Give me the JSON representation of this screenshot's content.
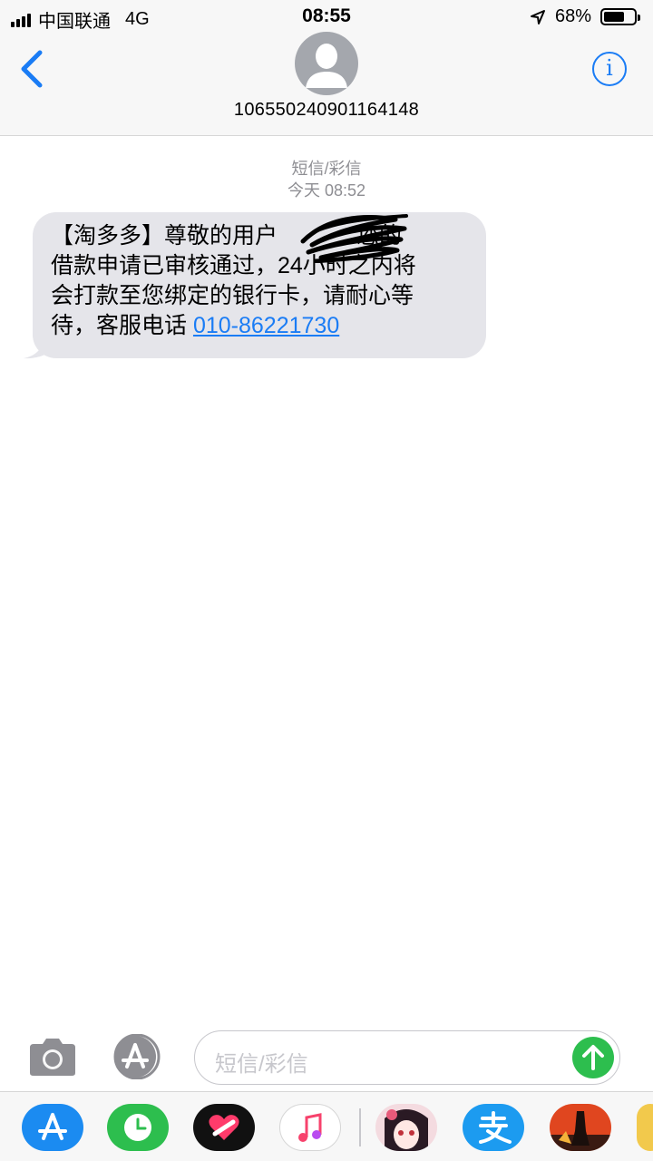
{
  "status_bar": {
    "carrier": "中国联通",
    "network": "4G",
    "time": "08:55",
    "battery_percent": "68%",
    "battery_level": 0.68
  },
  "header": {
    "contact": "10655024090116414​8",
    "info_glyph": "i"
  },
  "conversation": {
    "service": "短信/彩信",
    "date_time": "今天 08:52",
    "message": {
      "line1_a": "【淘多多】尊敬的用户",
      "line1_b": " 您的",
      "line2": "借款申请已审核通过，24小时之内将",
      "line3": "会打款至您绑定的银行卡，请耐心等",
      "line4": "待，客服电话 ",
      "phone": "010-86221730"
    }
  },
  "input_bar": {
    "placeholder": "短信/彩信"
  },
  "app_drawer": [
    "app-store-icon",
    "clock-icon",
    "heart-icon",
    "music-icon",
    "anime-game-icon",
    "alipay-icon",
    "action-game-icon",
    "partial-app-icon"
  ],
  "colors": {
    "accent": "#1a7cf5",
    "bubble": "#e5e5ea",
    "send": "#2dbe4e"
  }
}
